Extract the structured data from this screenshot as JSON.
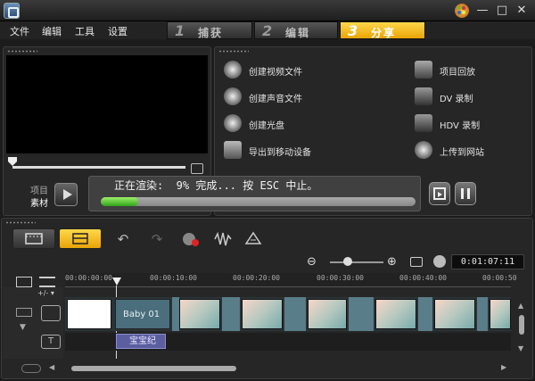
{
  "window": {
    "minimize": "—",
    "maximize": "□",
    "close": "✕"
  },
  "menu": {
    "items": [
      "文件",
      "编辑",
      "工具",
      "设置"
    ]
  },
  "steps": [
    {
      "num": "1",
      "label": "捕获",
      "active": false
    },
    {
      "num": "2",
      "label": "编辑",
      "active": false
    },
    {
      "num": "3",
      "label": "分享",
      "active": true
    }
  ],
  "share_options": {
    "left": [
      {
        "label": "创建视频文件",
        "icon": "film-reel-icon"
      },
      {
        "label": "创建声音文件",
        "icon": "audio-disc-icon"
      },
      {
        "label": "创建光盘",
        "icon": "disc-icon"
      },
      {
        "label": "导出到移动设备",
        "icon": "mobile-device-icon"
      }
    ],
    "right": [
      {
        "label": "项目回放",
        "icon": "playback-icon"
      },
      {
        "label": "DV 录制",
        "icon": "dv-camera-icon"
      },
      {
        "label": "HDV 录制",
        "icon": "hdv-camera-icon"
      },
      {
        "label": "上传到网站",
        "icon": "globe-icon"
      }
    ]
  },
  "preview": {
    "mode_project": "项目",
    "mode_clip": "素材"
  },
  "render": {
    "status_text": "正在渲染:  9% 完成... 按 ESC 中止。",
    "progress": 0.12
  },
  "timeline": {
    "timecode": "0:01:07:11",
    "ruler_ticks": [
      "00:00:00:00",
      "00:00:10:00",
      "00:00:20:00",
      "00:00:30:00",
      "00:00:40:00",
      "00:00:50"
    ],
    "video_clip_label": "Baby 01",
    "title_clip_label": "宝宝纪"
  }
}
